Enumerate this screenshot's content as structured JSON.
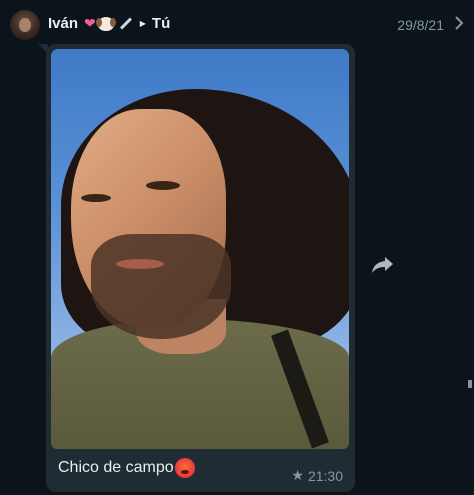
{
  "header": {
    "sender_name": "Iván",
    "sender_emojis": [
      "heart-with-ribbon",
      "dog-face",
      "dagger"
    ],
    "recipient": "Tú",
    "date": "29/8/21"
  },
  "message": {
    "caption": "Chico de campo",
    "caption_emoji": "hot-face",
    "time": "21:30",
    "starred": true
  },
  "colors": {
    "background": "#0b141a",
    "bubble": "#1f2c34",
    "meta_text": "#8696a0",
    "primary_text": "#e9edef"
  }
}
